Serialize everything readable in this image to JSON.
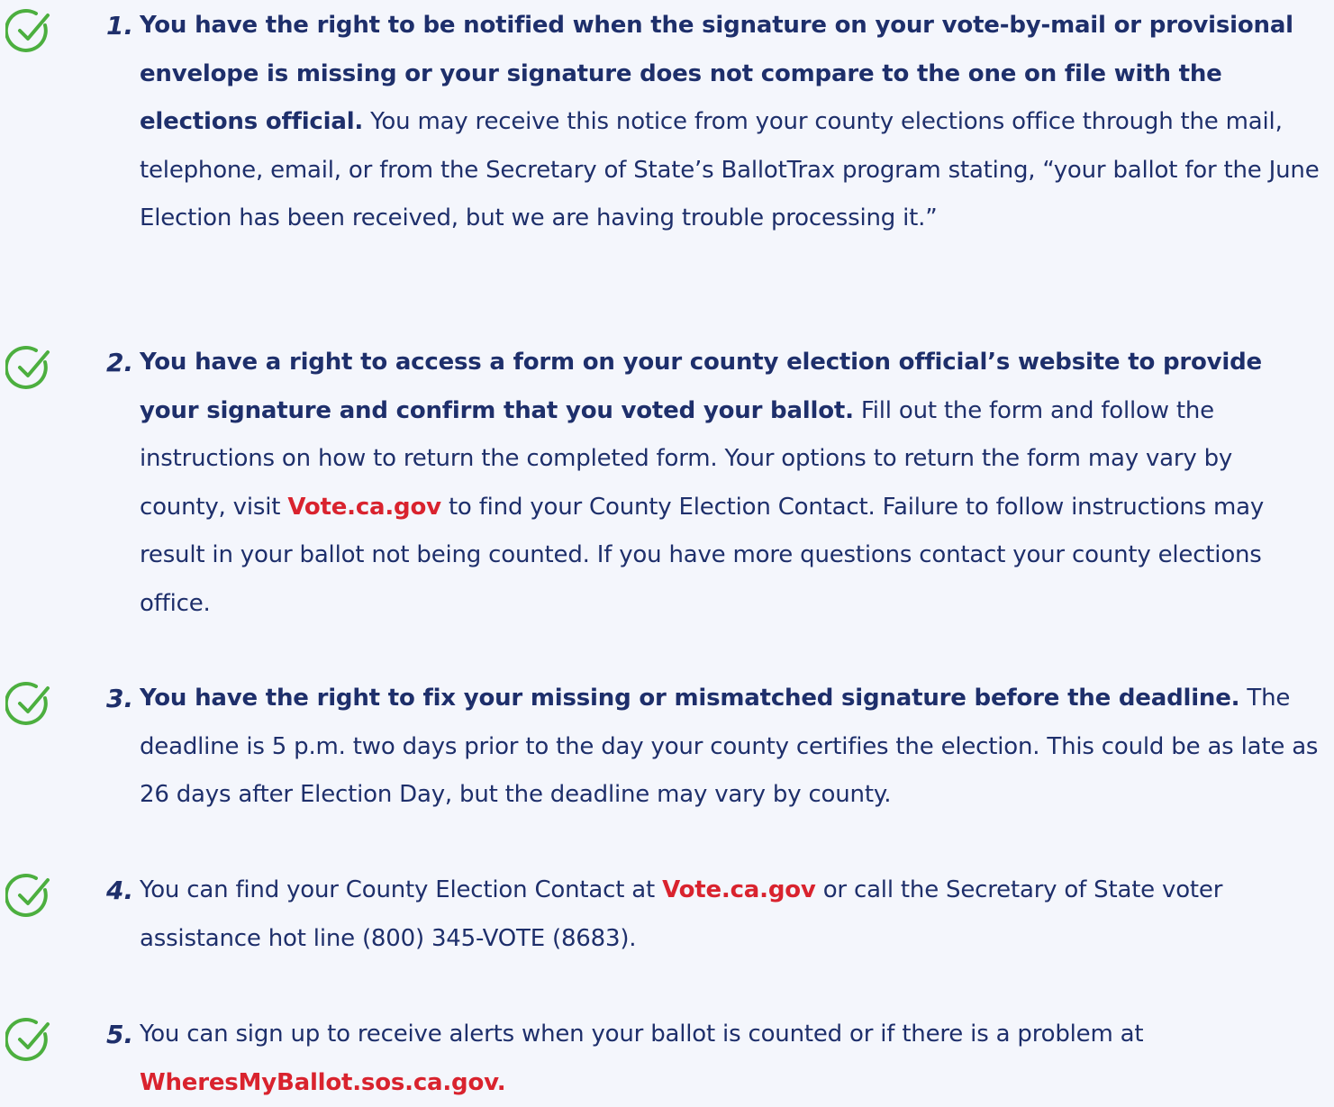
{
  "colors": {
    "background": "#f4f6fc",
    "text": "#1e2f6b",
    "link": "#d9232e",
    "check": "#4caf3f"
  },
  "items": [
    {
      "icon": "check-circle-icon",
      "number": "1.",
      "bold": "You have the right to be notified when the signature on your vote-by-mail or provisional envelope is missing or your signature does not compare to the one on file with the elections official.",
      "text": " You may receive this notice from your county elections office through the mail, telephone, email, or from the Secretary of State’s BallotTrax program stating, “your ballot for the June Election has been received, but we are having trouble processing it.”"
    },
    {
      "icon": "check-circle-icon",
      "number": "2.",
      "bold": "You have a right to access a form on your county election official’s website to provide your signature and confirm that you voted your ballot.",
      "text_before_link": " Fill out the form and follow the instructions on how to return the completed form. Your options to return the form may vary by county, visit ",
      "link": "Vote.ca.gov",
      "text_after_link": " to find your County Election Contact. Failure to follow instructions may result in your ballot not being counted. If you have more questions contact your county elections office."
    },
    {
      "icon": "check-circle-icon",
      "number": "3.",
      "bold": "You have the right to fix your missing or mismatched signature before the deadline.",
      "text": " The deadline is 5 p.m. two days prior to the day your county certifies the election. This could be as late as 26 days after Election Day, but the deadline may vary by county."
    },
    {
      "icon": "check-circle-icon",
      "number": "4.",
      "text_before_link": "You can find your County Election Contact at ",
      "link": "Vote.ca.gov",
      "text_after_link": " or call the Secretary of State voter assistance hot line (800) 345-VOTE (8683)."
    },
    {
      "icon": "check-circle-icon",
      "number": "5.",
      "text_before_link": "You can sign up to receive alerts when your ballot is counted or if there is a problem at ",
      "link": "WheresMyBallot.sos.ca.gov."
    }
  ]
}
